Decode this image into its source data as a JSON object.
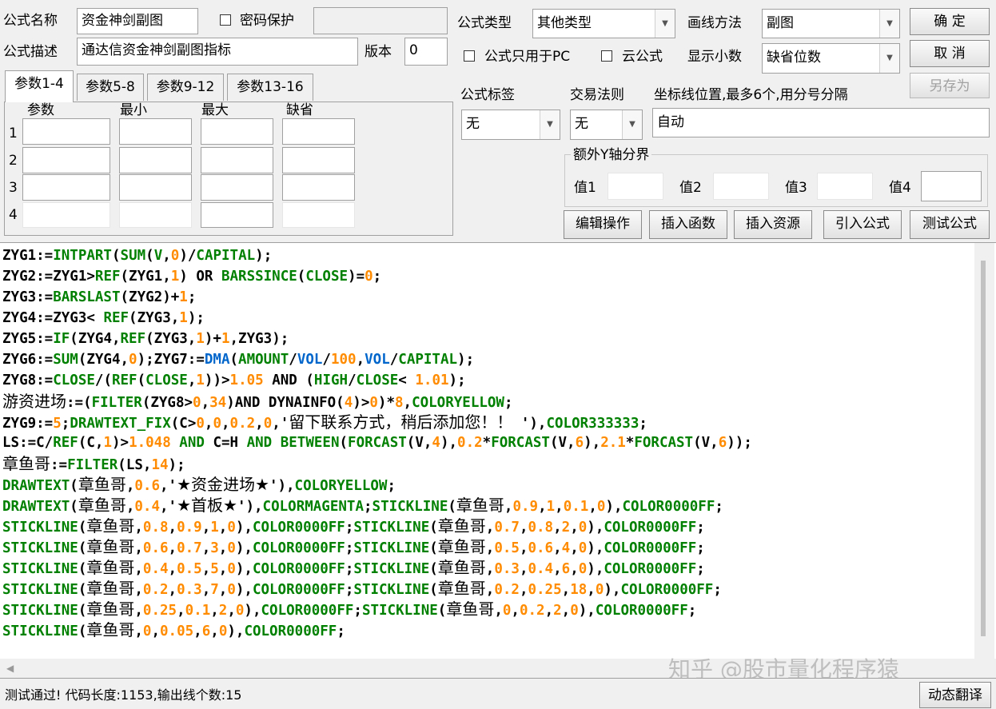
{
  "formula": {
    "name_label": "公式名称",
    "name_value": "资金神剑副图",
    "password_label": "密码保护",
    "desc_label": "公式描述",
    "desc_value": "通达信资金神剑副图指标",
    "version_label": "版本",
    "version_value": "0",
    "type_label": "公式类型",
    "type_value": "其他类型",
    "draw_label": "画线方法",
    "draw_value": "副图",
    "pc_only_label": "公式只用于PC",
    "cloud_label": "云公式",
    "decimals_label": "显示小数",
    "decimals_value": "缺省位数",
    "tag_label": "公式标签",
    "tag_value": "无",
    "rule_label": "交易法则",
    "rule_value": "无",
    "coord_label": "坐标线位置,最多6个,用分号分隔",
    "coord_value": "自动",
    "yaxis_group": "额外Y轴分界",
    "y1": "值1",
    "y2": "值2",
    "y3": "值3",
    "y4": "值4"
  },
  "buttons": {
    "ok": "确  定",
    "cancel": "取  消",
    "saveas": "另存为",
    "edit": "编辑操作",
    "insert_func": "插入函数",
    "insert_res": "插入资源",
    "import": "引入公式",
    "test": "测试公式",
    "translate": "动态翻译"
  },
  "params": {
    "tabs": [
      "参数1-4",
      "参数5-8",
      "参数9-12",
      "参数13-16"
    ],
    "headers": [
      "参数",
      "最小",
      "最大",
      "缺省"
    ],
    "rows": [
      "1",
      "2",
      "3",
      "4"
    ]
  },
  "code": [
    [
      [
        "t",
        "ZYG1:="
      ],
      [
        "k",
        "INTPART"
      ],
      [
        "t",
        "("
      ],
      [
        "k",
        "SUM"
      ],
      [
        "t",
        "("
      ],
      [
        "k",
        "V"
      ],
      [
        "t",
        ","
      ],
      [
        "n",
        "0"
      ],
      [
        "t",
        ")/"
      ],
      [
        "k",
        "CAPITAL"
      ],
      [
        "t",
        ");"
      ]
    ],
    [
      [
        "t",
        "ZYG2:=ZYG1>"
      ],
      [
        "k",
        "REF"
      ],
      [
        "t",
        "(ZYG1,"
      ],
      [
        "n",
        "1"
      ],
      [
        "t",
        ") OR "
      ],
      [
        "k",
        "BARSSINCE"
      ],
      [
        "t",
        "("
      ],
      [
        "k",
        "CLOSE"
      ],
      [
        "t",
        ")="
      ],
      [
        "n",
        "0"
      ],
      [
        "t",
        ";"
      ]
    ],
    [
      [
        "t",
        "ZYG3:="
      ],
      [
        "k",
        "BARSLAST"
      ],
      [
        "t",
        "(ZYG2)+"
      ],
      [
        "n",
        "1"
      ],
      [
        "t",
        ";"
      ]
    ],
    [
      [
        "t",
        "ZYG4:=ZYG3< "
      ],
      [
        "k",
        "REF"
      ],
      [
        "t",
        "(ZYG3,"
      ],
      [
        "n",
        "1"
      ],
      [
        "t",
        ");"
      ]
    ],
    [
      [
        "t",
        "ZYG5:="
      ],
      [
        "k",
        "IF"
      ],
      [
        "t",
        "(ZYG4,"
      ],
      [
        "k",
        "REF"
      ],
      [
        "t",
        "(ZYG3,"
      ],
      [
        "n",
        "1"
      ],
      [
        "t",
        ")+"
      ],
      [
        "n",
        "1"
      ],
      [
        "t",
        ",ZYG3);"
      ]
    ],
    [
      [
        "t",
        "ZYG6:="
      ],
      [
        "k",
        "SUM"
      ],
      [
        "t",
        "(ZYG4,"
      ],
      [
        "n",
        "0"
      ],
      [
        "t",
        ");ZYG7:="
      ],
      [
        "b",
        "DMA"
      ],
      [
        "t",
        "("
      ],
      [
        "k",
        "AMOUNT"
      ],
      [
        "t",
        "/"
      ],
      [
        "b",
        "VOL"
      ],
      [
        "t",
        "/"
      ],
      [
        "n",
        "100"
      ],
      [
        "t",
        ","
      ],
      [
        "b",
        "VOL"
      ],
      [
        "t",
        "/"
      ],
      [
        "k",
        "CAPITAL"
      ],
      [
        "t",
        ");"
      ]
    ],
    [
      [
        "t",
        "ZYG8:="
      ],
      [
        "k",
        "CLOSE"
      ],
      [
        "t",
        "/("
      ],
      [
        "k",
        "REF"
      ],
      [
        "t",
        "("
      ],
      [
        "k",
        "CLOSE"
      ],
      [
        "t",
        ","
      ],
      [
        "n",
        "1"
      ],
      [
        "t",
        "))>"
      ],
      [
        "n",
        "1.05"
      ],
      [
        "t",
        " AND ("
      ],
      [
        "k",
        "HIGH"
      ],
      [
        "t",
        "/"
      ],
      [
        "k",
        "CLOSE"
      ],
      [
        "t",
        "< "
      ],
      [
        "n",
        "1.01"
      ],
      [
        "t",
        ");"
      ]
    ],
    [
      [
        "c",
        "游资进场"
      ],
      [
        "t",
        ":=("
      ],
      [
        "k",
        "FILTER"
      ],
      [
        "t",
        "(ZYG8>"
      ],
      [
        "n",
        "0"
      ],
      [
        "t",
        ","
      ],
      [
        "n",
        "34"
      ],
      [
        "t",
        ")AND DYNAINFO("
      ],
      [
        "n",
        "4"
      ],
      [
        "t",
        ")>"
      ],
      [
        "n",
        "0"
      ],
      [
        "t",
        ")*"
      ],
      [
        "n",
        "8"
      ],
      [
        "t",
        ","
      ],
      [
        "k",
        "COLORYELLOW"
      ],
      [
        "t",
        ";"
      ]
    ],
    [
      [
        "t",
        "ZYG9:="
      ],
      [
        "n",
        "5"
      ],
      [
        "t",
        ";"
      ],
      [
        "k",
        "DRAWTEXT_FIX"
      ],
      [
        "t",
        "(C>"
      ],
      [
        "n",
        "0"
      ],
      [
        "t",
        ","
      ],
      [
        "n",
        "0"
      ],
      [
        "t",
        ","
      ],
      [
        "n",
        "0.2"
      ],
      [
        "t",
        ","
      ],
      [
        "n",
        "0"
      ],
      [
        "t",
        ",'"
      ],
      [
        "c",
        "留下联系方式，稍后添加您！！"
      ],
      [
        "t",
        " '),"
      ],
      [
        "k",
        "COLOR333333"
      ],
      [
        "t",
        ";"
      ]
    ],
    [
      [
        "t",
        "LS:=C/"
      ],
      [
        "k",
        "REF"
      ],
      [
        "t",
        "(C,"
      ],
      [
        "n",
        "1"
      ],
      [
        "t",
        ")>"
      ],
      [
        "n",
        "1.048"
      ],
      [
        "k",
        " AND "
      ],
      [
        "t",
        "C=H"
      ],
      [
        "k",
        " AND BETWEEN"
      ],
      [
        "t",
        "("
      ],
      [
        "k",
        "FORCAST"
      ],
      [
        "t",
        "(V,"
      ],
      [
        "n",
        "4"
      ],
      [
        "t",
        "),"
      ],
      [
        "n",
        "0.2"
      ],
      [
        "t",
        "*"
      ],
      [
        "k",
        "FORCAST"
      ],
      [
        "t",
        "(V,"
      ],
      [
        "n",
        "6"
      ],
      [
        "t",
        "),"
      ],
      [
        "n",
        "2.1"
      ],
      [
        "t",
        "*"
      ],
      [
        "k",
        "FORCAST"
      ],
      [
        "t",
        "(V,"
      ],
      [
        "n",
        "6"
      ],
      [
        "t",
        "));"
      ]
    ],
    [
      [
        "c",
        "章鱼哥"
      ],
      [
        "t",
        ":="
      ],
      [
        "k",
        "FILTER"
      ],
      [
        "t",
        "(LS,"
      ],
      [
        "n",
        "14"
      ],
      [
        "t",
        ");"
      ]
    ],
    [
      [
        "k",
        "DRAWTEXT"
      ],
      [
        "t",
        "("
      ],
      [
        "c",
        "章鱼哥"
      ],
      [
        "t",
        ","
      ],
      [
        "n",
        "0.6"
      ],
      [
        "t",
        ",'"
      ],
      [
        "c",
        "★资金进场★"
      ],
      [
        "t",
        "'),"
      ],
      [
        "k",
        "COLORYELLOW"
      ],
      [
        "t",
        ";"
      ]
    ],
    [
      [
        "k",
        "DRAWTEXT"
      ],
      [
        "t",
        "("
      ],
      [
        "c",
        "章鱼哥"
      ],
      [
        "t",
        ","
      ],
      [
        "n",
        "0.4"
      ],
      [
        "t",
        ",'"
      ],
      [
        "c",
        "★首板★"
      ],
      [
        "t",
        "'),"
      ],
      [
        "k",
        "COLORMAGENTA"
      ],
      [
        "t",
        ";"
      ],
      [
        "k",
        "STICKLINE"
      ],
      [
        "t",
        "("
      ],
      [
        "c",
        "章鱼哥"
      ],
      [
        "t",
        ","
      ],
      [
        "n",
        "0.9"
      ],
      [
        "t",
        ","
      ],
      [
        "n",
        "1"
      ],
      [
        "t",
        ","
      ],
      [
        "n",
        "0.1"
      ],
      [
        "t",
        ","
      ],
      [
        "n",
        "0"
      ],
      [
        "t",
        "),"
      ],
      [
        "k",
        "COLOR0000FF"
      ],
      [
        "t",
        ";"
      ]
    ],
    [
      [
        "k",
        "STICKLINE"
      ],
      [
        "t",
        "("
      ],
      [
        "c",
        "章鱼哥"
      ],
      [
        "t",
        ","
      ],
      [
        "n",
        "0.8"
      ],
      [
        "t",
        ","
      ],
      [
        "n",
        "0.9"
      ],
      [
        "t",
        ","
      ],
      [
        "n",
        "1"
      ],
      [
        "t",
        ","
      ],
      [
        "n",
        "0"
      ],
      [
        "t",
        "),"
      ],
      [
        "k",
        "COLOR0000FF"
      ],
      [
        "t",
        ";"
      ],
      [
        "k",
        "STICKLINE"
      ],
      [
        "t",
        "("
      ],
      [
        "c",
        "章鱼哥"
      ],
      [
        "t",
        ","
      ],
      [
        "n",
        "0.7"
      ],
      [
        "t",
        ","
      ],
      [
        "n",
        "0.8"
      ],
      [
        "t",
        ","
      ],
      [
        "n",
        "2"
      ],
      [
        "t",
        ","
      ],
      [
        "n",
        "0"
      ],
      [
        "t",
        "),"
      ],
      [
        "k",
        "COLOR0000FF"
      ],
      [
        "t",
        ";"
      ]
    ],
    [
      [
        "k",
        "STICKLINE"
      ],
      [
        "t",
        "("
      ],
      [
        "c",
        "章鱼哥"
      ],
      [
        "t",
        ","
      ],
      [
        "n",
        "0.6"
      ],
      [
        "t",
        ","
      ],
      [
        "n",
        "0.7"
      ],
      [
        "t",
        ","
      ],
      [
        "n",
        "3"
      ],
      [
        "t",
        ","
      ],
      [
        "n",
        "0"
      ],
      [
        "t",
        "),"
      ],
      [
        "k",
        "COLOR0000FF"
      ],
      [
        "t",
        ";"
      ],
      [
        "k",
        "STICKLINE"
      ],
      [
        "t",
        "("
      ],
      [
        "c",
        "章鱼哥"
      ],
      [
        "t",
        ","
      ],
      [
        "n",
        "0.5"
      ],
      [
        "t",
        ","
      ],
      [
        "n",
        "0.6"
      ],
      [
        "t",
        ","
      ],
      [
        "n",
        "4"
      ],
      [
        "t",
        ","
      ],
      [
        "n",
        "0"
      ],
      [
        "t",
        "),"
      ],
      [
        "k",
        "COLOR0000FF"
      ],
      [
        "t",
        ";"
      ]
    ],
    [
      [
        "k",
        "STICKLINE"
      ],
      [
        "t",
        "("
      ],
      [
        "c",
        "章鱼哥"
      ],
      [
        "t",
        ","
      ],
      [
        "n",
        "0.4"
      ],
      [
        "t",
        ","
      ],
      [
        "n",
        "0.5"
      ],
      [
        "t",
        ","
      ],
      [
        "n",
        "5"
      ],
      [
        "t",
        ","
      ],
      [
        "n",
        "0"
      ],
      [
        "t",
        "),"
      ],
      [
        "k",
        "COLOR0000FF"
      ],
      [
        "t",
        ";"
      ],
      [
        "k",
        "STICKLINE"
      ],
      [
        "t",
        "("
      ],
      [
        "c",
        "章鱼哥"
      ],
      [
        "t",
        ","
      ],
      [
        "n",
        "0.3"
      ],
      [
        "t",
        ","
      ],
      [
        "n",
        "0.4"
      ],
      [
        "t",
        ","
      ],
      [
        "n",
        "6"
      ],
      [
        "t",
        ","
      ],
      [
        "n",
        "0"
      ],
      [
        "t",
        "),"
      ],
      [
        "k",
        "COLOR0000FF"
      ],
      [
        "t",
        ";"
      ]
    ],
    [
      [
        "k",
        "STICKLINE"
      ],
      [
        "t",
        "("
      ],
      [
        "c",
        "章鱼哥"
      ],
      [
        "t",
        ","
      ],
      [
        "n",
        "0.2"
      ],
      [
        "t",
        ","
      ],
      [
        "n",
        "0.3"
      ],
      [
        "t",
        ","
      ],
      [
        "n",
        "7"
      ],
      [
        "t",
        ","
      ],
      [
        "n",
        "0"
      ],
      [
        "t",
        "),"
      ],
      [
        "k",
        "COLOR0000FF"
      ],
      [
        "t",
        ";"
      ],
      [
        "k",
        "STICKLINE"
      ],
      [
        "t",
        "("
      ],
      [
        "c",
        "章鱼哥"
      ],
      [
        "t",
        ","
      ],
      [
        "n",
        "0.2"
      ],
      [
        "t",
        ","
      ],
      [
        "n",
        "0.25"
      ],
      [
        "t",
        ","
      ],
      [
        "n",
        "18"
      ],
      [
        "t",
        ","
      ],
      [
        "n",
        "0"
      ],
      [
        "t",
        "),"
      ],
      [
        "k",
        "COLOR0000FF"
      ],
      [
        "t",
        ";"
      ]
    ],
    [
      [
        "k",
        "STICKLINE"
      ],
      [
        "t",
        "("
      ],
      [
        "c",
        "章鱼哥"
      ],
      [
        "t",
        ","
      ],
      [
        "n",
        "0.25"
      ],
      [
        "t",
        ","
      ],
      [
        "n",
        "0.1"
      ],
      [
        "t",
        ","
      ],
      [
        "n",
        "2"
      ],
      [
        "t",
        ","
      ],
      [
        "n",
        "0"
      ],
      [
        "t",
        "),"
      ],
      [
        "k",
        "COLOR0000FF"
      ],
      [
        "t",
        ";"
      ],
      [
        "k",
        "STICKLINE"
      ],
      [
        "t",
        "("
      ],
      [
        "c",
        "章鱼哥"
      ],
      [
        "t",
        ","
      ],
      [
        "n",
        "0"
      ],
      [
        "t",
        ","
      ],
      [
        "n",
        "0.2"
      ],
      [
        "t",
        ","
      ],
      [
        "n",
        "2"
      ],
      [
        "t",
        ","
      ],
      [
        "n",
        "0"
      ],
      [
        "t",
        "),"
      ],
      [
        "k",
        "COLOR0000FF"
      ],
      [
        "t",
        ";"
      ]
    ],
    [
      [
        "k",
        "STICKLINE"
      ],
      [
        "t",
        "("
      ],
      [
        "c",
        "章鱼哥"
      ],
      [
        "t",
        ","
      ],
      [
        "n",
        "0"
      ],
      [
        "t",
        ","
      ],
      [
        "n",
        "0.05"
      ],
      [
        "t",
        ","
      ],
      [
        "n",
        "6"
      ],
      [
        "t",
        ","
      ],
      [
        "n",
        "0"
      ],
      [
        "t",
        "),"
      ],
      [
        "k",
        "COLOR0000FF"
      ],
      [
        "t",
        ";"
      ]
    ]
  ],
  "status": "测试通过! 代码长度:1153,输出线个数:15",
  "watermark": "知乎 @股市量化程序猿",
  "icons": {
    "dropdown": "chevron-down-icon",
    "scroll_left": "arrow-left-icon"
  }
}
